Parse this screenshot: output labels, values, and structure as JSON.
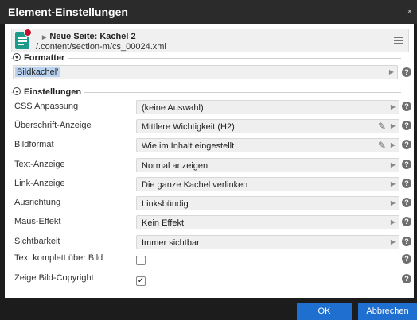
{
  "window": {
    "title": "Element-Einstellungen",
    "close_glyph": "×"
  },
  "resource": {
    "title": "Neue Seite: Kachel 2",
    "path": "/.content/section-m/cs_00024.xml",
    "icon": "tile-content-icon"
  },
  "formatter": {
    "legend": "Formatter",
    "value": "Bildkachel'"
  },
  "settings": {
    "legend": "Einstellungen",
    "rows": [
      {
        "label": "CSS Anpassung",
        "value": "(keine Auswahl)"
      },
      {
        "label": "Überschrift-Anzeige",
        "value": "Mittlere Wichtigkeit (H2)"
      },
      {
        "label": "Bildformat",
        "value": "Wie im Inhalt eingestellt"
      },
      {
        "label": "Text-Anzeige",
        "value": "Normal anzeigen"
      },
      {
        "label": "Link-Anzeige",
        "value": "Die ganze Kachel verlinken"
      },
      {
        "label": "Ausrichtung",
        "value": "Linksbündig"
      },
      {
        "label": "Maus-Effekt",
        "value": "Kein Effekt"
      },
      {
        "label": "Sichtbarkeit",
        "value": "Immer sichtbar"
      }
    ],
    "checks": [
      {
        "label": "Text komplett über Bild",
        "checked": false
      },
      {
        "label": "Zeige Bild-Copyright",
        "checked": true,
        "mark": "✓"
      }
    ]
  },
  "help_glyph": "?",
  "buttons": {
    "ok": "OK",
    "cancel": "Abbrechen"
  },
  "colors": {
    "primary": "#1f6fd1",
    "icon_teal": "#1e9b8a",
    "icon_badge": "#c8102e"
  }
}
